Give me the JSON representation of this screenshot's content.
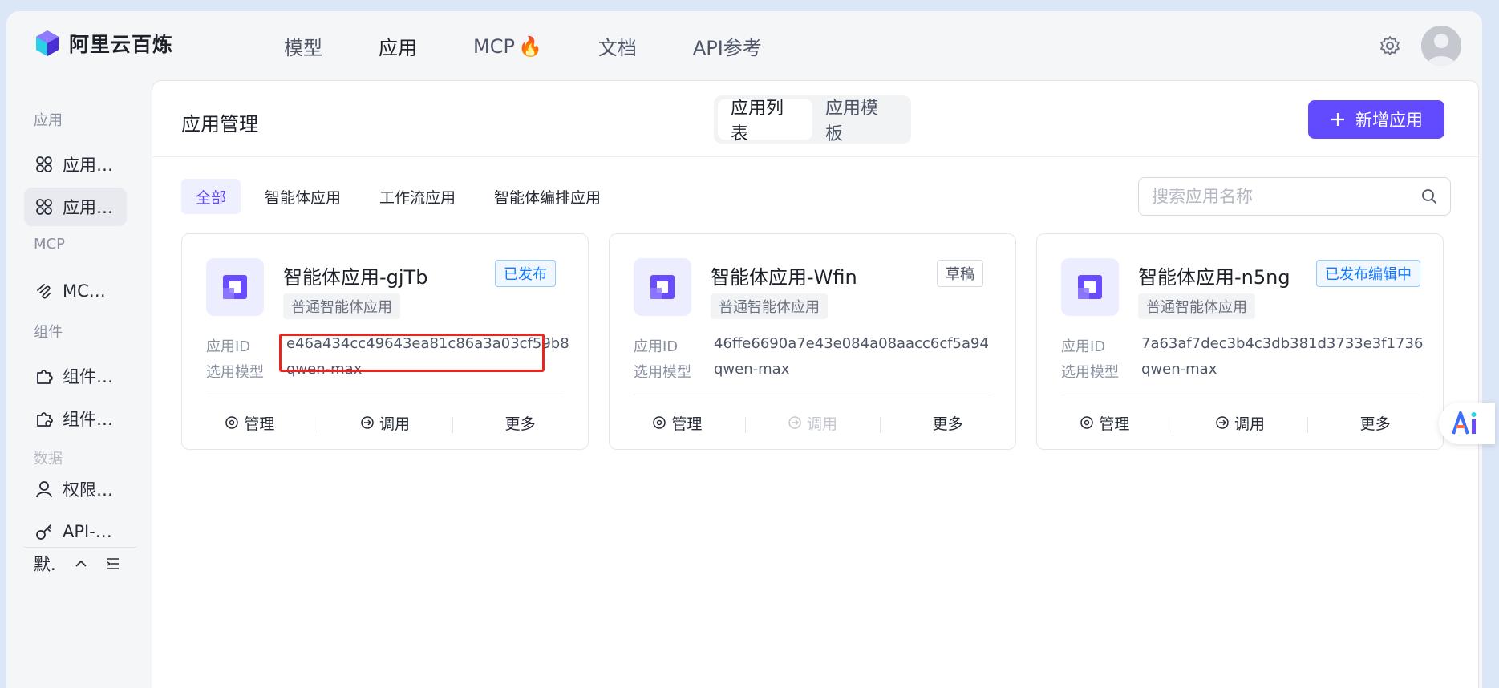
{
  "brand": {
    "name": "阿里云百炼"
  },
  "nav": {
    "links": [
      {
        "label": "模型"
      },
      {
        "label": "应用",
        "active": true
      },
      {
        "label": "MCP",
        "emoji": "🔥"
      },
      {
        "label": "文档"
      },
      {
        "label": "API参考"
      }
    ]
  },
  "sidebar": {
    "sections": {
      "app": "应用",
      "mcp": "MCP",
      "component": "组件",
      "data": "数据"
    },
    "items": [
      {
        "label": "应用…",
        "icon": "apps-icon"
      },
      {
        "label": "应用…",
        "icon": "apps-icon",
        "active": true
      },
      {
        "label": "MC…",
        "icon": "mcp-icon"
      },
      {
        "label": "组件…",
        "icon": "puzzle-icon"
      },
      {
        "label": "组件…",
        "icon": "puzzle-settings-icon"
      },
      {
        "label": "权限…",
        "icon": "user-icon"
      },
      {
        "label": "API-…",
        "icon": "key-icon"
      }
    ],
    "footer": {
      "label": "默."
    }
  },
  "main": {
    "title": "应用管理",
    "tabs": [
      {
        "label": "应用列表",
        "active": true
      },
      {
        "label": "应用模板"
      }
    ],
    "add_button": "新增应用",
    "filters": [
      {
        "label": "全部",
        "active": true
      },
      {
        "label": "智能体应用"
      },
      {
        "label": "工作流应用"
      },
      {
        "label": "智能体编排应用"
      }
    ],
    "search_placeholder": "搜索应用名称",
    "cards": [
      {
        "name": "智能体应用-gjTb",
        "type": "普通智能体应用",
        "badge": "已发布",
        "badge_style": "blue",
        "id_label": "应用ID",
        "id": "e46a434cc49643ea81c86a3a03cf59b8",
        "model_label": "选用模型",
        "model": "qwen-max",
        "actions": [
          "管理",
          "调用",
          "更多"
        ],
        "invoke_disabled": false
      },
      {
        "name": "智能体应用-Wfin",
        "type": "普通智能体应用",
        "badge": "草稿",
        "badge_style": "gray",
        "id_label": "应用ID",
        "id": "46ffe6690a7e43e084a08aacc6cf5a94",
        "model_label": "选用模型",
        "model": "qwen-max",
        "actions": [
          "管理",
          "调用",
          "更多"
        ],
        "invoke_disabled": true
      },
      {
        "name": "智能体应用-n5ng",
        "type": "普通智能体应用",
        "badge": "已发布编辑中",
        "badge_style": "blue",
        "id_label": "应用ID",
        "id": "7a63af7dec3b4c3db381d3733e3f1736",
        "model_label": "选用模型",
        "model": "qwen-max",
        "actions": [
          "管理",
          "调用",
          "更多"
        ],
        "invoke_disabled": false
      }
    ]
  },
  "colors": {
    "accent": "#624aff",
    "highlight": "#e8251f",
    "badge_blue": "#1677ff"
  }
}
